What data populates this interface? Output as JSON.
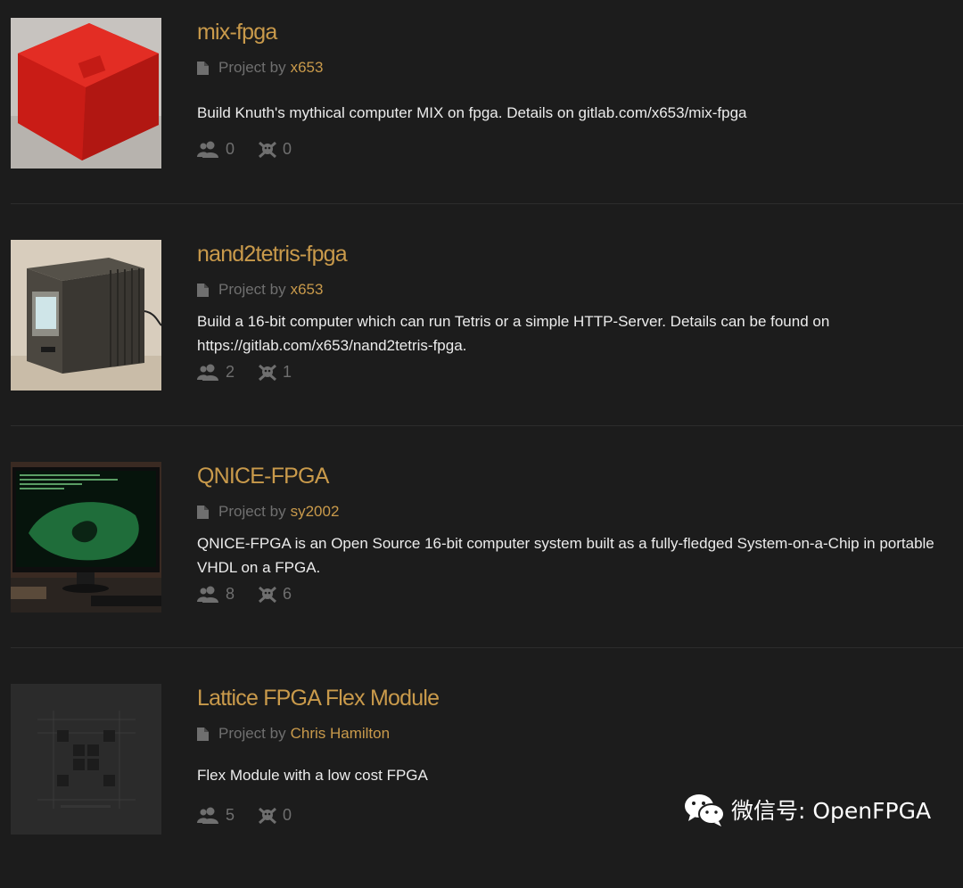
{
  "projects": [
    {
      "title": "mix-fpga",
      "byline_prefix": "Project by",
      "author": "x653",
      "description": "Build Knuth's mythical computer MIX on fpga. Details on gitlab.com/x653/mix-fpga",
      "followers": "0",
      "skulls": "0",
      "thumbnail": "red-box-photo"
    },
    {
      "title": "nand2tetris-fpga",
      "byline_prefix": "Project by",
      "author": "x653",
      "description": "Build a 16-bit computer which can run Tetris or a simple HTTP-Server. Details can be found on https://gitlab.com/x653/nand2tetris-fpga.",
      "followers": "2",
      "skulls": "1",
      "thumbnail": "cube-computer-photo"
    },
    {
      "title": "QNICE-FPGA",
      "byline_prefix": "Project by",
      "author": "sy2002",
      "description": "QNICE-FPGA is an Open Source 16-bit computer system built as a fully-fledged System-on-a-Chip in portable VHDL on a FPGA.",
      "followers": "8",
      "skulls": "6",
      "thumbnail": "monitor-mandelbrot-photo"
    },
    {
      "title": "Lattice FPGA Flex Module",
      "byline_prefix": "Project by",
      "author": "Chris Hamilton",
      "description": "Flex Module with a low cost FPGA",
      "followers": "5",
      "skulls": "0",
      "thumbnail": "default-placeholder-logo"
    }
  ],
  "watermark": {
    "text": "微信号: OpenFPGA"
  },
  "colors": {
    "accent": "#c99a4b",
    "background": "#1c1c1c",
    "muted": "#6f6f6f"
  },
  "icons": [
    "document-icon",
    "followers-icon",
    "skull-icon",
    "wechat-icon"
  ]
}
